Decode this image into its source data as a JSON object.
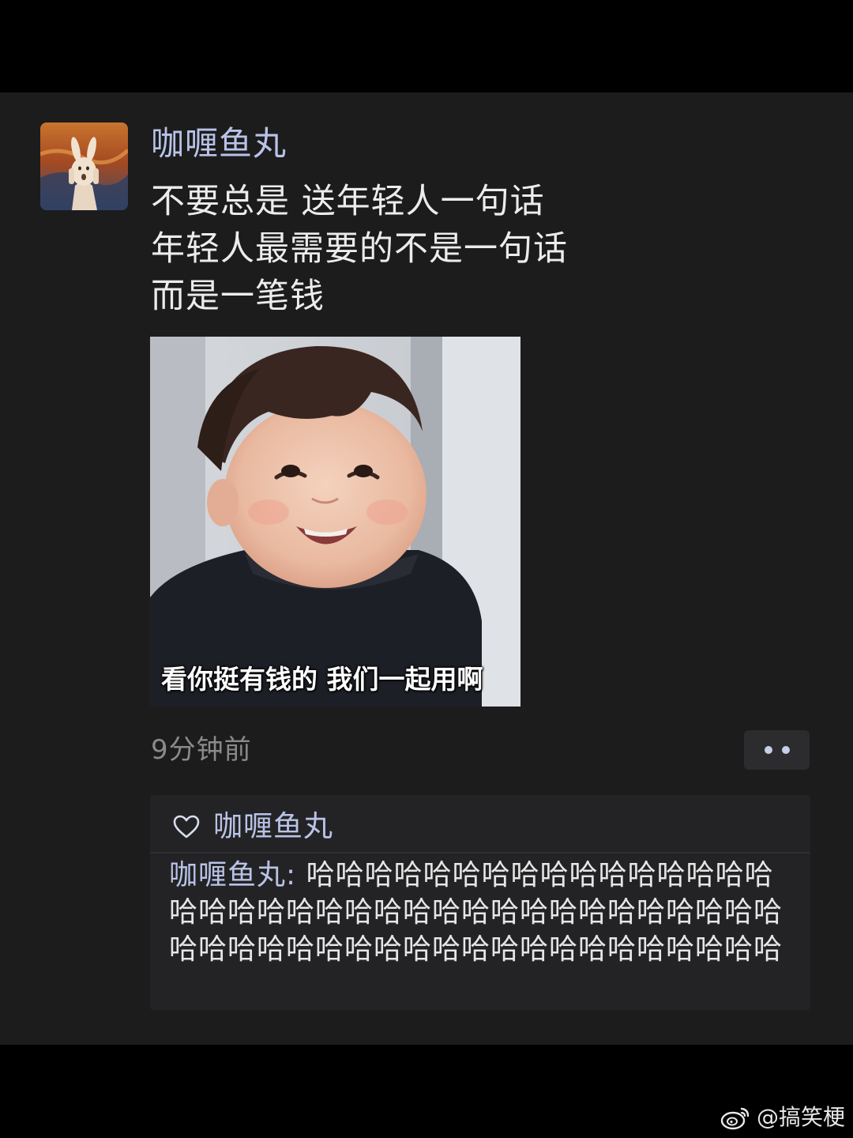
{
  "post": {
    "username": "咖喱鱼丸",
    "lines": [
      "不要总是 送年轻人一句话",
      "年轻人最需要的不是一句话",
      "而是一笔钱"
    ],
    "image_caption": "看你挺有钱的 我们一起用啊",
    "time": "9分钟前"
  },
  "likes": {
    "icon": "heart-icon",
    "names": "咖喱鱼丸"
  },
  "comment": {
    "author": "咖喱鱼丸",
    "separator": ": ",
    "text": "哈哈哈哈哈哈哈哈哈哈哈哈哈哈哈哈哈哈哈哈哈哈哈哈哈哈哈哈哈哈哈哈哈哈哈哈哈哈哈哈哈哈哈哈哈哈哈哈哈哈哈哈哈哈哈哈哈哈"
  },
  "watermark": {
    "icon": "weibo-icon",
    "text": "@搞笑梗"
  },
  "colors": {
    "name_blue": "#b9c3e6",
    "background": "#1c1c1d",
    "comment_bg": "#232325"
  }
}
